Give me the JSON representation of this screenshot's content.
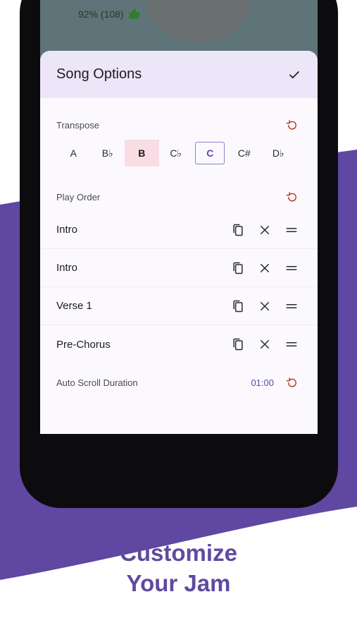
{
  "colors": {
    "accent_purple": "#5f4aa0",
    "header_bg": "#ece6f8",
    "selected_key_bg": "#fadce5",
    "reset_red": "#c0392b",
    "like_green": "#2e7d32"
  },
  "background_song": {
    "rating_text": "92% (108)",
    "rating_icon": "thumbs-up-icon"
  },
  "sheet": {
    "title": "Song Options",
    "done_icon": "check-icon"
  },
  "transpose": {
    "label": "Transpose",
    "reset_icon": "reset-icon",
    "keys": [
      "A",
      "B♭",
      "B",
      "C♭",
      "C",
      "C#",
      "D♭"
    ],
    "selected_key": "B",
    "original_key": "C"
  },
  "play_order": {
    "label": "Play Order",
    "reset_icon": "reset-icon",
    "items": [
      {
        "label": "Intro"
      },
      {
        "label": "Intro"
      },
      {
        "label": "Verse 1"
      },
      {
        "label": "Pre-Chorus"
      }
    ],
    "action_icons": [
      "copy-icon",
      "close-icon",
      "drag-handle-icon"
    ]
  },
  "auto_scroll": {
    "label": "Auto Scroll Duration",
    "value": "01:00",
    "reset_icon": "reset-icon"
  },
  "tagline": {
    "line1": "Customize",
    "line2": "Your Jam"
  }
}
